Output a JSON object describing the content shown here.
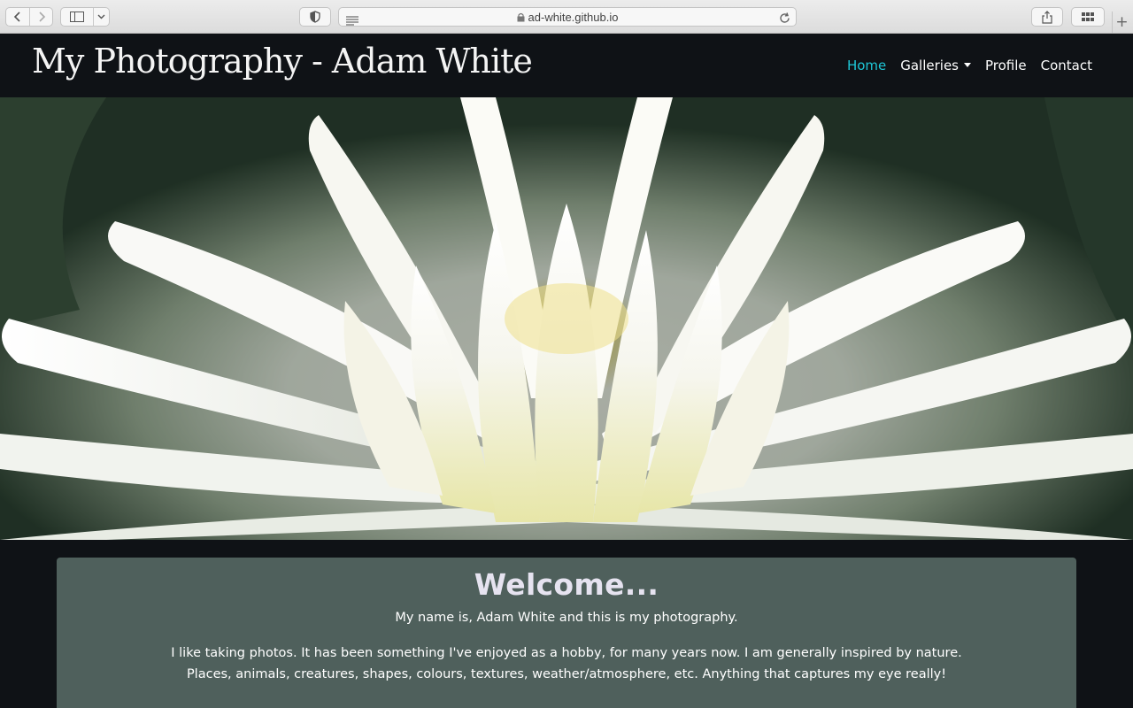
{
  "browser": {
    "url": "ad-white.github.io",
    "icons": {
      "back": "chevron-left-icon",
      "forward": "chevron-right-icon",
      "sidebar": "sidebar-icon",
      "shield": "shield-icon",
      "reader": "reader-icon",
      "lock": "lock-icon",
      "reload": "reload-icon",
      "share": "share-icon",
      "tabs": "tab-overview-icon",
      "new_tab": "plus-icon"
    },
    "new_tab_label": "+"
  },
  "site": {
    "title": "My Photography - Adam White",
    "nav": {
      "home": "Home",
      "galleries": "Galleries",
      "profile": "Profile",
      "contact": "Contact"
    },
    "accent_color": "#1ec6d6"
  },
  "welcome": {
    "heading": "Welcome...",
    "intro": "My name is, Adam White and this is my photography.",
    "paragraph": "I like taking photos. It has been something I've enjoyed as a hobby, for many years now. I am generally inspired by nature. Places, animals, creatures, shapes, colours, textures, weather/atmosphere, etc. Anything that captures my eye really!"
  }
}
